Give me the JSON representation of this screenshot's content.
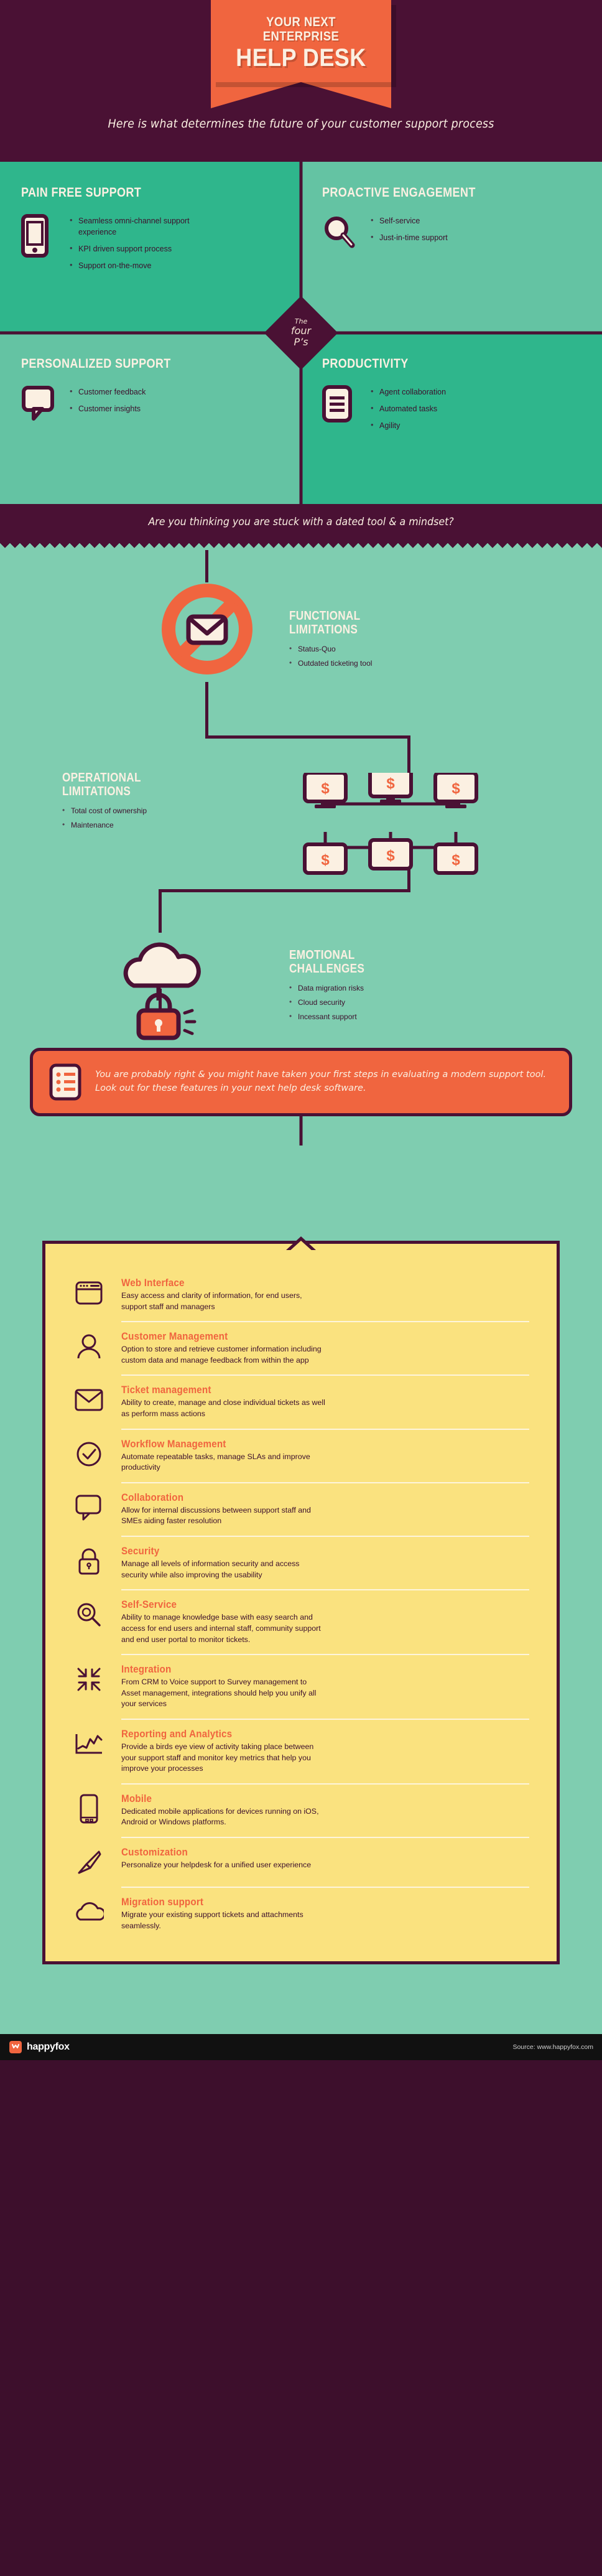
{
  "header": {
    "kicker": "YOUR NEXT ENTERPRISE",
    "title": "HELP DESK",
    "subtitle": "Here is what determines the future of your customer support process"
  },
  "four_ps": {
    "badge_small": "The",
    "badge_big_1": "four",
    "badge_big_2": "P’s",
    "quadrants": [
      {
        "title": "PAIN FREE SUPPORT",
        "icon": "smartphone-icon",
        "bullets": [
          "Seamless omni-channel support experience",
          "KPI driven support process",
          "Support on-the-move"
        ]
      },
      {
        "title": "PROACTIVE ENGAGEMENT",
        "icon": "magnifier-icon",
        "bullets": [
          "Self-service",
          "Just-in-time support"
        ]
      },
      {
        "title": "PERSONALIZED SUPPORT",
        "icon": "speech-bubble-icon",
        "bullets": [
          "Customer feedback",
          "Customer insights"
        ]
      },
      {
        "title": "PRODUCTIVITY",
        "icon": "document-lines-icon",
        "bullets": [
          "Agent collaboration",
          "Automated tasks",
          "Agility"
        ]
      }
    ]
  },
  "question_banner": {
    "text": "Are you thinking you are stuck with a dated tool & a mindset?"
  },
  "limitations": [
    {
      "title_line1": "FUNCTIONAL",
      "title_line2": "LIMITATIONS",
      "icon": "no-email-icon",
      "bullets": [
        "Status-Quo",
        "Outdated ticketing tool"
      ]
    },
    {
      "title_line1": "OPERATIONAL",
      "title_line2": "LIMITATIONS",
      "icon": "monitors-dollar-icon",
      "bullets": [
        "Total cost of ownership",
        "Maintenance"
      ]
    },
    {
      "title_line1": "EMOTIONAL",
      "title_line2": "CHALLENGES",
      "icon": "cloud-lock-icon",
      "bullets": [
        "Data migration risks",
        "Cloud security",
        "Incessant support"
      ]
    }
  ],
  "callout": {
    "icon": "checklist-icon",
    "text": "You are probably right & you might have taken your first steps in evaluating a modern support tool. Look out for these features in your next help desk software."
  },
  "features": [
    {
      "icon": "browser-window-icon",
      "name": "Web Interface",
      "desc": "Easy access and clarity of information, for end users, support staff and managers"
    },
    {
      "icon": "user-icon",
      "name": "Customer Management",
      "desc": "Option to store and retrieve customer information including custom data and manage feedback from within the app"
    },
    {
      "icon": "envelope-icon",
      "name": "Ticket management",
      "desc": "Ability to create, manage and close individual tickets as well as perform mass actions"
    },
    {
      "icon": "check-circle-icon",
      "name": "Workflow Management",
      "desc": "Automate repeatable tasks, manage SLAs and improve productivity"
    },
    {
      "icon": "chat-bubble-icon",
      "name": "Collaboration",
      "desc": "Allow for internal discussions between support staff and SMEs aiding faster resolution"
    },
    {
      "icon": "padlock-icon",
      "name": "Security",
      "desc": "Manage all levels of information security and access security while also improving the usability"
    },
    {
      "icon": "magnifier-icon",
      "name": "Self-Service",
      "desc": "Ability to manage knowledge base with easy search and access for end users and internal staff, community support and end user portal to monitor tickets."
    },
    {
      "icon": "integration-arrows-icon",
      "name": "Integration",
      "desc": "From CRM to Voice support to Survey management to Asset management, integrations should help you unify all your services"
    },
    {
      "icon": "line-chart-icon",
      "name": "Reporting and Analytics",
      "desc": "Provide a birds eye view of activity taking place between your support staff and monitor key metrics that help you improve your processes"
    },
    {
      "icon": "mobile-phone-icon",
      "name": "Mobile",
      "desc": "Dedicated mobile applications for devices running on iOS, Android or Windows platforms."
    },
    {
      "icon": "paintbrush-icon",
      "name": "Customization",
      "desc": "Personalize your helpdesk for a unified user experience"
    },
    {
      "icon": "cloud-icon",
      "name": "Migration support",
      "desc": "Migrate your existing support tickets and attachments seamlessly."
    }
  ],
  "footer": {
    "brand": "happyfox",
    "source": "Source: www.happyfox.com"
  },
  "colors": {
    "plum": "#4a1134",
    "orange": "#f0653f",
    "green_dark": "#2fb68c",
    "green_mid": "#64c3a3",
    "green_light": "#7fcdb0",
    "cream": "#fbf0e2",
    "yellow": "#fae27f"
  }
}
